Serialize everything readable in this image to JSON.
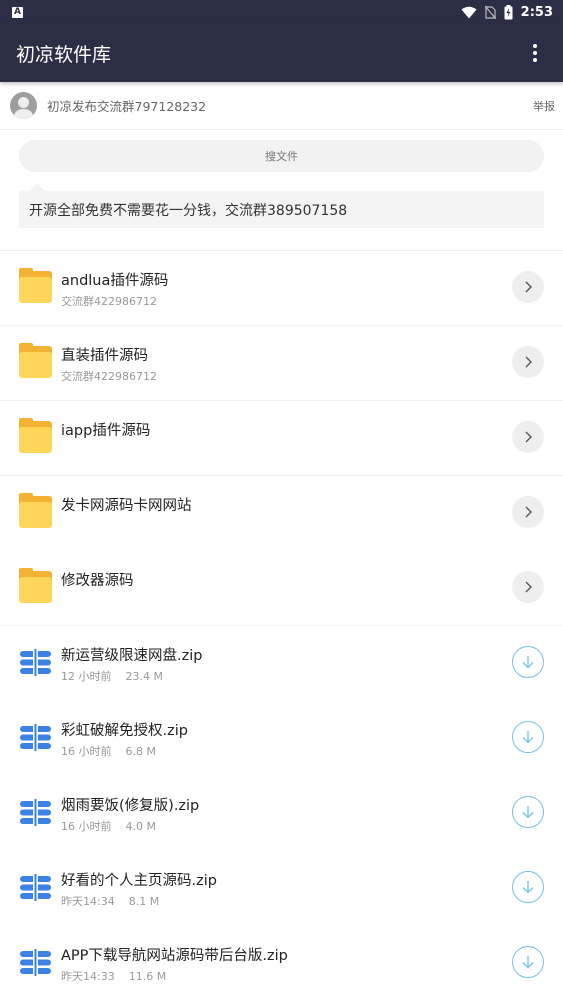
{
  "status_bar": {
    "left_icon": "A",
    "time": "2:53",
    "icons": [
      "wifi-icon",
      "no-sim-icon",
      "battery-charging-icon"
    ]
  },
  "app_bar": {
    "title": "初凉软件库",
    "menu_icon": "more-vertical-icon"
  },
  "user_bar": {
    "text": "初凉发布交流群797128232",
    "report_label": "举报"
  },
  "search": {
    "label": "搜文件"
  },
  "notice": {
    "text": "开源全部免费不需要花一分钱，交流群389507158"
  },
  "colors": {
    "header": "#2c2e45",
    "folder": "#ffd65a",
    "file_icon": "#3b82e6",
    "download": "#71c2ec"
  },
  "folders": [
    {
      "title": "andlua插件源码",
      "subtitle": "交流群422986712"
    },
    {
      "title": "直装插件源码",
      "subtitle": "交流群422986712"
    },
    {
      "title": "iapp插件源码",
      "subtitle": ""
    },
    {
      "title": "发卡网源码卡网网站",
      "subtitle": ""
    },
    {
      "title": "修改器源码",
      "subtitle": ""
    }
  ],
  "files": [
    {
      "title": "新运营级限速网盘.zip",
      "time": "12 小时前",
      "size": "23.4 M"
    },
    {
      "title": "彩虹破解免授权.zip",
      "time": "16 小时前",
      "size": "6.8 M"
    },
    {
      "title": "烟雨要饭(修复版).zip",
      "time": "16 小时前",
      "size": "4.0 M"
    },
    {
      "title": "好看的个人主页源码.zip",
      "time": "昨天14:34",
      "size": "8.1 M"
    },
    {
      "title": "APP下载导航网站源码带后台版.zip",
      "time": "昨天14:33",
      "size": "11.6 M"
    }
  ]
}
